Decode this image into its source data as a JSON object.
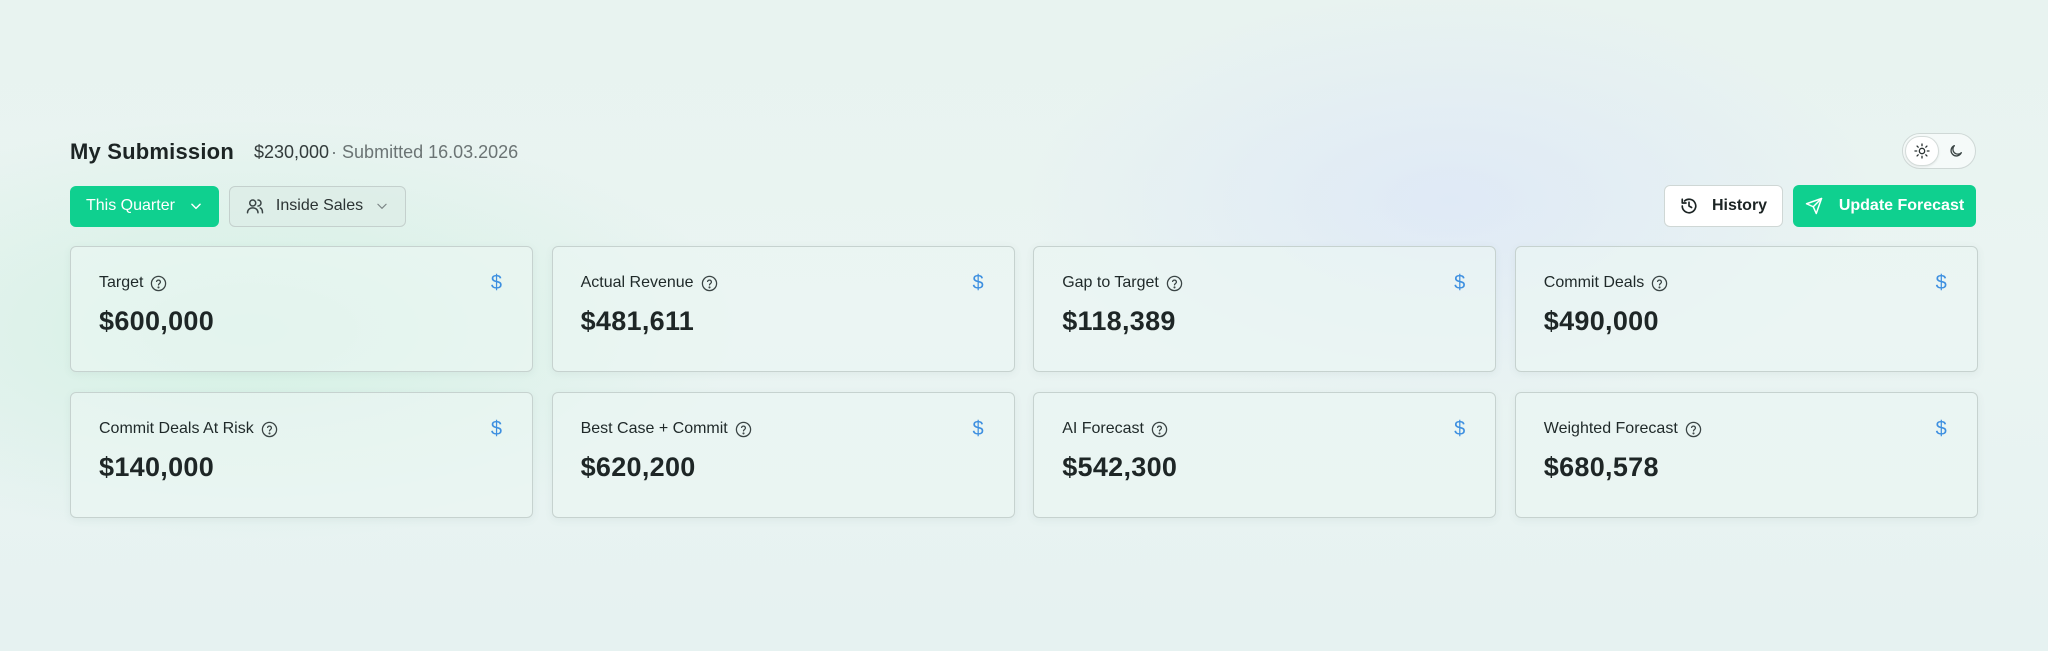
{
  "header": {
    "title": "My Submission",
    "amount": "$230,000",
    "submitted": "· Submitted 16.03.2026"
  },
  "controls": {
    "period_label": "This Quarter",
    "team_label": "Inside Sales",
    "history_label": "History",
    "update_label": "Update Forecast"
  },
  "colors": {
    "accent": "#0fd08f",
    "currency_icon": "#3d8fe0"
  },
  "theme": {
    "active": "light"
  },
  "metrics": [
    {
      "label": "Target",
      "value": "$600,000",
      "icon": "dollar-icon"
    },
    {
      "label": "Actual Revenue",
      "value": "$481,611",
      "icon": "dollar-icon"
    },
    {
      "label": "Gap to Target",
      "value": "$118,389",
      "icon": "dollar-icon"
    },
    {
      "label": "Commit Deals",
      "value": "$490,000",
      "icon": "dollar-icon"
    },
    {
      "label": "Commit Deals At Risk",
      "value": "$140,000",
      "icon": "dollar-icon"
    },
    {
      "label": "Best Case + Commit",
      "value": "$620,200",
      "icon": "dollar-icon"
    },
    {
      "label": "AI Forecast",
      "value": "$542,300",
      "icon": "dollar-icon"
    },
    {
      "label": "Weighted Forecast",
      "value": "$680,578",
      "icon": "dollar-icon"
    }
  ]
}
